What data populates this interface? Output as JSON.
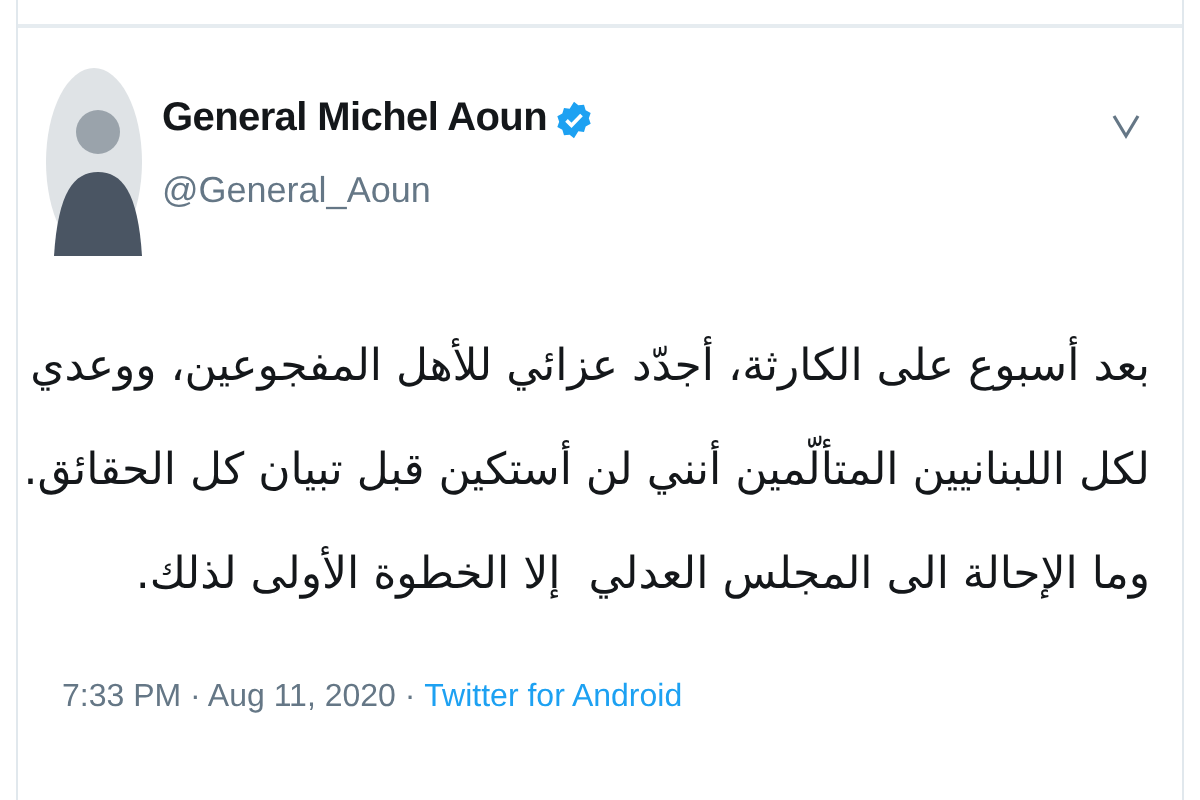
{
  "author": {
    "name": "General Michel Aoun",
    "verified": true,
    "handle": "@General_Aoun"
  },
  "tweet": {
    "lines": [
      "بعد أسبوع على الكارثة، أجدّد عزائي للأهل المفجوعين، ووعدي",
      "لكل اللبنانيين المتألّمين أنني لن أستكين قبل تبيان كل الحقائق.",
      "وما الإحالة الى المجلس العدلي  إلا الخطوة الأولى لذلك."
    ]
  },
  "meta": {
    "timestamp": "7:33 PM · Aug 11, 2020 · ",
    "source": "Twitter for Android"
  }
}
